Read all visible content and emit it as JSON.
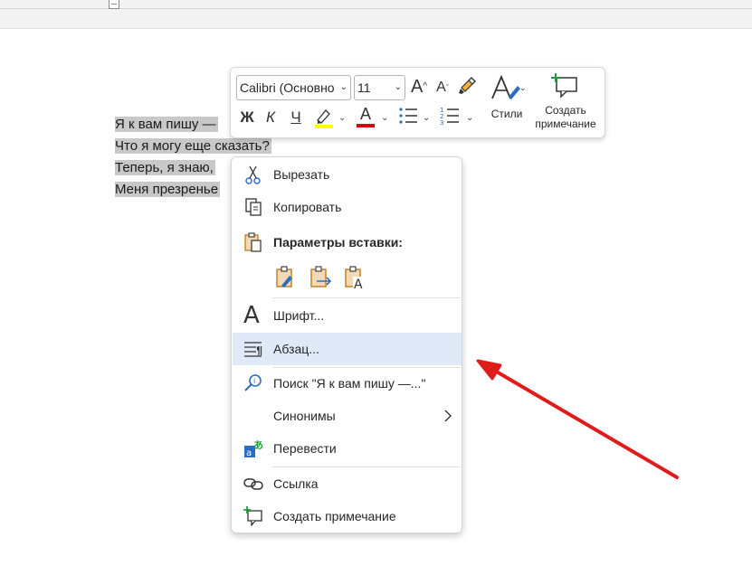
{
  "document": {
    "lines": [
      "Я к вам пишу —",
      "Что я могу еще сказать?",
      "Теперь, я знаю,",
      "Меня презренье"
    ]
  },
  "mini_toolbar": {
    "font_name": "Calibri (Основно",
    "font_size": "11",
    "bold": "Ж",
    "italic": "К",
    "underline": "Ч",
    "font_color_letter": "A",
    "styles_label": "Стили",
    "comment_label_line1": "Создать",
    "comment_label_line2": "примечание",
    "colors": {
      "highlight": "#ffff00",
      "font_color": "#e00000"
    }
  },
  "context_menu": {
    "cut": "Вырезать",
    "copy": "Копировать",
    "paste_options": "Параметры вставки:",
    "font": "Шрифт...",
    "paragraph": "Абзац...",
    "search": "Поиск \"Я к вам пишу —...\"",
    "synonyms": "Синонимы",
    "translate": "Перевести",
    "link": "Ссылка",
    "new_comment": "Создать примечание",
    "highlight_color": "#dfe9f8"
  },
  "annotation": {
    "arrow_color": "#e01b1b"
  }
}
